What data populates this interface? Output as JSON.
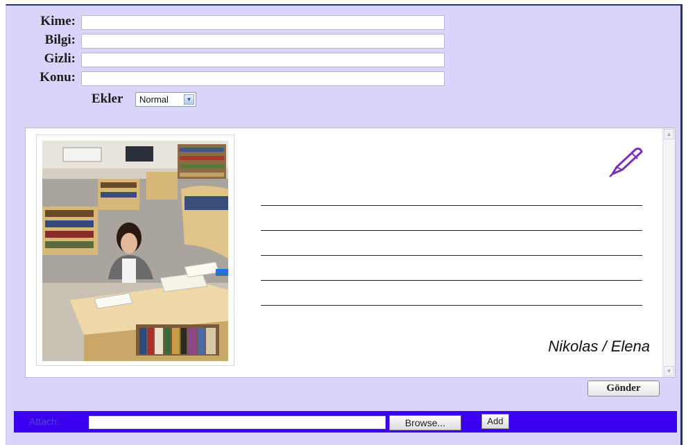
{
  "form": {
    "to_label": "Kime:",
    "to_value": "",
    "cc_label": "Bilgi:",
    "cc_value": "",
    "bcc_label": "Gizli:",
    "bcc_value": "",
    "subject_label": "Konu:",
    "subject_value": "",
    "attachments_label": "Ekler",
    "format_selected": "Normal"
  },
  "editor": {
    "signature": "Nikolas / Elena",
    "line_count": 5,
    "image": "student-studying-in-library-photo",
    "pen_icon_color": "#7b2fb6"
  },
  "send_button": "Gönder",
  "attach": {
    "label": "Attach:",
    "file_value": "",
    "browse_label": "Browse...",
    "add_label": "Add",
    "bar_color": "#3a00ef"
  },
  "colors": {
    "background": "#d9d4fa",
    "frame_border": "#23307a"
  }
}
